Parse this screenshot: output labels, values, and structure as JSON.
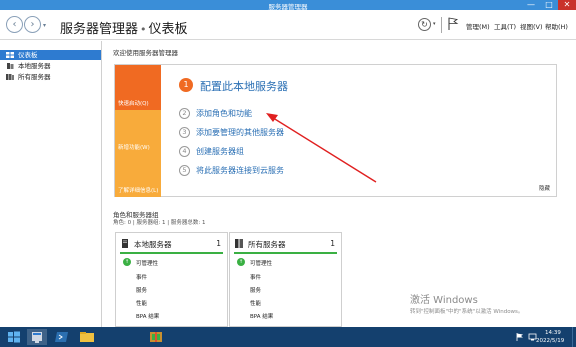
{
  "window": {
    "title": "服务器管理器",
    "minimize": "—",
    "maximize": "□",
    "close": "✕"
  },
  "header": {
    "back": "‹",
    "forward": "›",
    "app_name": "服务器管理器",
    "separator": "•",
    "page_name": "仪表板",
    "refresh": "↻",
    "menus": {
      "manage": "管理(M)",
      "tools": "工具(T)",
      "view": "视图(V)",
      "help": "帮助(H)"
    }
  },
  "sidebar": {
    "items": [
      {
        "label": "仪表板",
        "icon": "dashboard-icon",
        "active": true
      },
      {
        "label": "本地服务器",
        "icon": "local-server-icon",
        "active": false
      },
      {
        "label": "所有服务器",
        "icon": "all-servers-icon",
        "active": false
      }
    ]
  },
  "main": {
    "welcome": "欢迎使用服务器管理器",
    "tiles": {
      "quick_start": "快速启动(Q)",
      "whats_new": "新增功能(W)",
      "learn_more": "了解详细信息(L)"
    },
    "configure": {
      "number": "1",
      "title": "配置此本地服务器"
    },
    "steps": [
      {
        "number": "2",
        "label": "添加角色和功能"
      },
      {
        "number": "3",
        "label": "添加要管理的其他服务器"
      },
      {
        "number": "4",
        "label": "创建服务器组"
      },
      {
        "number": "5",
        "label": "将此服务器连接到云服务"
      }
    ],
    "hide": "隐藏",
    "groups_title": "角色和服务器组",
    "groups_subtitle": "角色: 0 | 服务器组: 1 | 服务器总数: 1",
    "cards": [
      {
        "title": "本地服务器",
        "count": "1",
        "rows": [
          "可管理性",
          "事件",
          "服务",
          "性能",
          "BPA 结果"
        ]
      },
      {
        "title": "所有服务器",
        "count": "1",
        "rows": [
          "可管理性",
          "事件",
          "服务",
          "性能",
          "BPA 结果"
        ]
      }
    ],
    "ok_glyph": "↑"
  },
  "activation": {
    "title": "激活 Windows",
    "subtitle": "转到\"控制面板\"中的\"系统\"以激活 Windows。"
  },
  "taskbar": {
    "time": "14:39",
    "date": "2022/5/19"
  },
  "colors": {
    "accent": "#2e7bd0",
    "orange": "#f06a22",
    "yellow": "#f8ab3b",
    "green": "#3ab043",
    "taskbar": "#14406e",
    "arrow": "#e02020"
  }
}
